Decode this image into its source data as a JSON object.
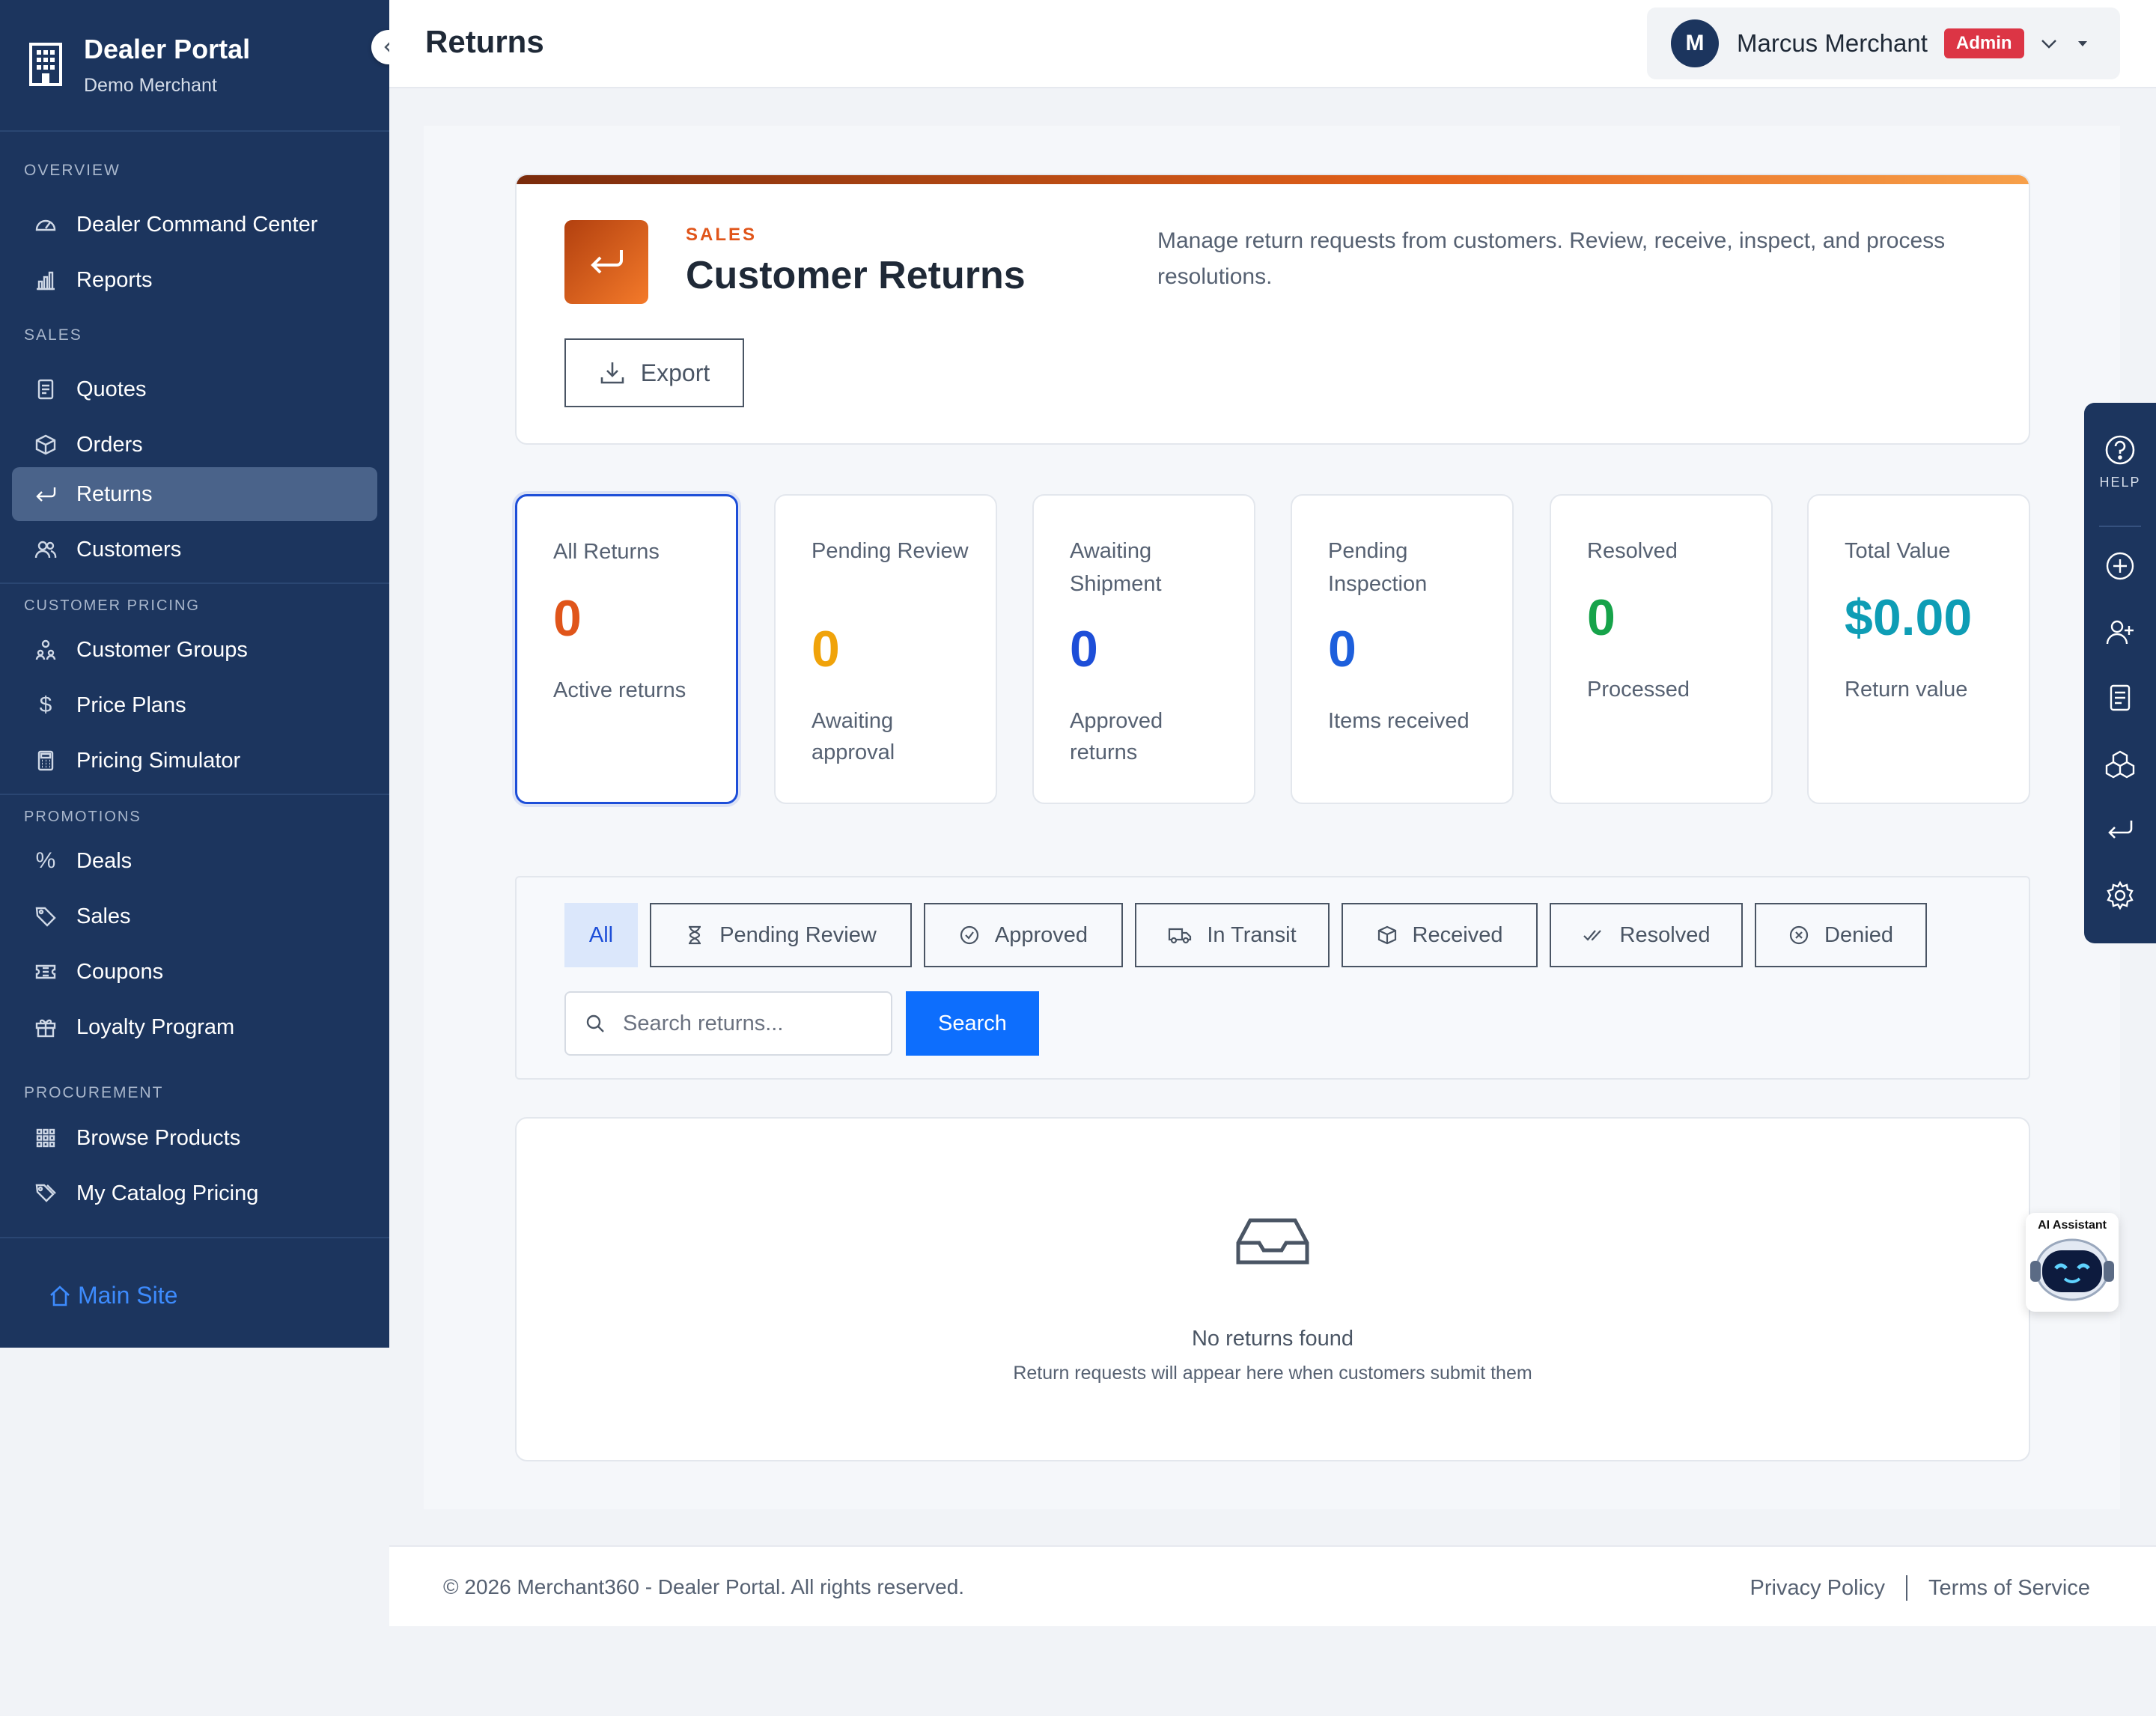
{
  "sidebar": {
    "brand_title": "Dealer Portal",
    "brand_subtitle": "Demo Merchant",
    "sections": {
      "overview": "OVERVIEW",
      "sales": "SALES",
      "customer_pricing": "CUSTOMER PRICING",
      "promotions": "PROMOTIONS",
      "procurement": "PROCUREMENT"
    },
    "items": {
      "command_center": "Dealer Command Center",
      "reports": "Reports",
      "quotes": "Quotes",
      "orders": "Orders",
      "returns": "Returns",
      "customers": "Customers",
      "customer_groups": "Customer Groups",
      "price_plans": "Price Plans",
      "pricing_simulator": "Pricing Simulator",
      "deals": "Deals",
      "sales": "Sales",
      "coupons": "Coupons",
      "loyalty_program": "Loyalty Program",
      "browse_products": "Browse Products",
      "my_catalog_pricing": "My Catalog Pricing"
    },
    "active_item": "Returns",
    "main_site": "Main Site"
  },
  "header": {
    "title": "Returns",
    "user_initial": "M",
    "user_name": "Marcus Merchant",
    "role_badge": "Admin"
  },
  "hero": {
    "eyebrow": "SALES",
    "title": "Customer Returns",
    "description": "Manage return requests from customers. Review, receive, inspect, and process resolutions.",
    "export_label": "Export"
  },
  "stats": [
    {
      "label": "All Returns",
      "value": "0",
      "sub": "Active returns",
      "color": "#e0551a"
    },
    {
      "label": "Pending Review",
      "value": "0",
      "sub": "Awaiting approval",
      "color": "#f0a30a"
    },
    {
      "label": "Awaiting Shipment",
      "value": "0",
      "sub": "Approved returns",
      "color": "#1d4ed8"
    },
    {
      "label": "Pending Inspection",
      "value": "0",
      "sub": "Items received",
      "color": "#1d5fdc"
    },
    {
      "label": "Resolved",
      "value": "0",
      "sub": "Processed",
      "color": "#16a34a"
    },
    {
      "label": "Total Value",
      "value": "$0.00",
      "sub": "Return value",
      "color": "#0e9db5"
    }
  ],
  "filters": {
    "tabs": [
      "All",
      "Pending Review",
      "Approved",
      "In Transit",
      "Received",
      "Resolved",
      "Denied"
    ],
    "active_tab": "All",
    "search_placeholder": "Search returns...",
    "search_button": "Search"
  },
  "empty_state": {
    "title": "No returns found",
    "subtitle": "Return requests will appear here when customers submit them"
  },
  "footer": {
    "copyright": "© 2026 Merchant360 - Dealer Portal. All rights reserved.",
    "privacy": "Privacy Policy",
    "terms": "Terms of Service"
  },
  "right_rail": {
    "help_label": "HELP"
  },
  "ai_widget": {
    "label": "AI Assistant"
  }
}
